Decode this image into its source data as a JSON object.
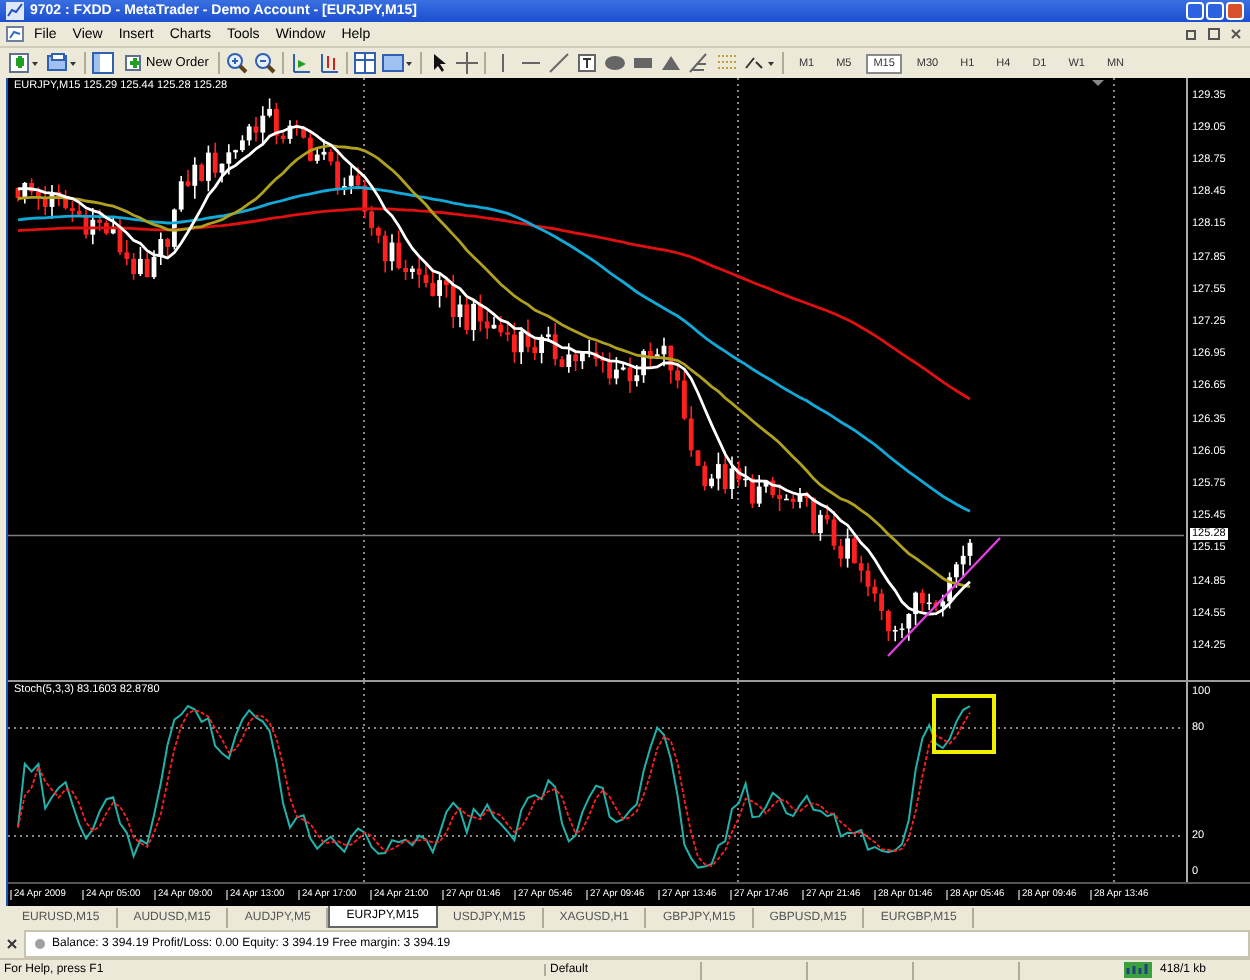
{
  "window": {
    "title": "9702 : FXDD - MetaTrader - Demo Account - [EURJPY,M15]"
  },
  "menu": [
    "File",
    "View",
    "Insert",
    "Charts",
    "Tools",
    "Window",
    "Help"
  ],
  "toolbar": {
    "new_order": "New Order",
    "timeframes": [
      {
        "label": "M1",
        "selected": false
      },
      {
        "label": "M5",
        "selected": false
      },
      {
        "label": "M15",
        "selected": true
      },
      {
        "label": "M30",
        "selected": false
      },
      {
        "label": "H1",
        "selected": false
      },
      {
        "label": "H4",
        "selected": false
      },
      {
        "label": "D1",
        "selected": false
      },
      {
        "label": "W1",
        "selected": false
      },
      {
        "label": "MN",
        "selected": false
      }
    ]
  },
  "chart": {
    "info": "EURJPY,M15  125.29 125.44 125.28 125.28",
    "price_axis": [
      "129.35",
      "129.05",
      "128.75",
      "128.45",
      "128.15",
      "127.85",
      "127.55",
      "127.25",
      "126.95",
      "126.65",
      "126.35",
      "126.05",
      "125.75",
      "125.45",
      "125.15",
      "124.85",
      "124.55",
      "124.25"
    ],
    "current_price": "125.28",
    "indicator": {
      "label": "Stoch(5,3,3) 83.1603 82.8780",
      "levels": [
        "100",
        "80",
        "20",
        "0"
      ]
    },
    "time_axis": [
      "24 Apr 2009",
      "24 Apr 05:00",
      "24 Apr 09:00",
      "24 Apr 13:00",
      "24 Apr 17:00",
      "24 Apr 21:00",
      "27 Apr 01:46",
      "27 Apr 05:46",
      "27 Apr 09:46",
      "27 Apr 13:46",
      "27 Apr 17:46",
      "27 Apr 21:46",
      "28 Apr 01:46",
      "28 Apr 05:46",
      "28 Apr 09:46",
      "28 Apr 13:46"
    ]
  },
  "chart_tabs": [
    {
      "label": "EURUSD,M15",
      "selected": false
    },
    {
      "label": "AUDUSD,M15",
      "selected": false
    },
    {
      "label": "AUDJPY,M5",
      "selected": false
    },
    {
      "label": "EURJPY,M15",
      "selected": true
    },
    {
      "label": "USDJPY,M15",
      "selected": false
    },
    {
      "label": "XAGUSD,H1",
      "selected": false
    },
    {
      "label": "GBPJPY,M15",
      "selected": false
    },
    {
      "label": "GBPUSD,M15",
      "selected": false
    },
    {
      "label": "EURGBP,M15",
      "selected": false
    }
  ],
  "terminal": {
    "account": "Balance: 3 394.19  Profit/Loss: 0.00  Equity: 3 394.19  Free margin: 3 394.19"
  },
  "status_bar": {
    "help": "For Help, press F1",
    "profile": "Default",
    "traffic": "418/1 kb"
  }
}
